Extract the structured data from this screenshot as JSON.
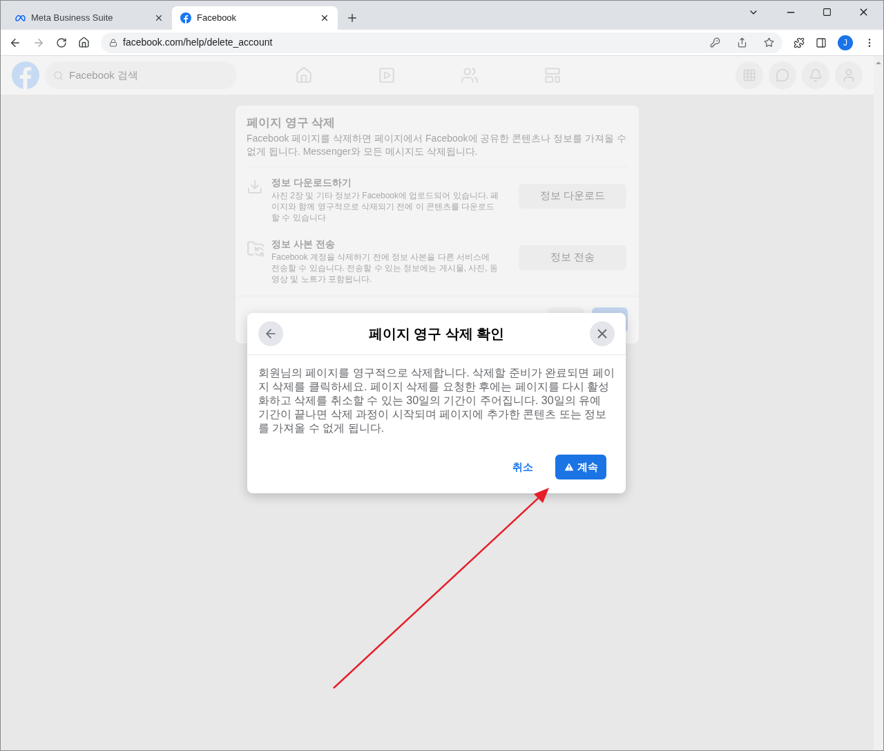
{
  "browser": {
    "tabs": [
      {
        "title": "Meta Business Suite",
        "selected": false
      },
      {
        "title": "Facebook",
        "selected": true
      }
    ],
    "address": "facebook.com/help/delete_account",
    "profile_initial": "J"
  },
  "header": {
    "search_placeholder": "Facebook 검색"
  },
  "background_card": {
    "title": "페이지 영구 삭제",
    "description": "Facebook 페이지를 삭제하면 페이지에서 Facebook에 공유한 콘텐츠나 정보를 가져올 수 없게 됩니다. Messenger와 모든 메시지도 삭제됩니다.",
    "options": [
      {
        "kind": "download",
        "title": "정보 다운로드하기",
        "text": "사진 2장 및 기타 정보가 Facebook에 업로드되어 있습니다. 페이지와 함께 영구적으로 삭제되기 전에 이 콘텐츠를 다운로드할 수 있습니다",
        "button": "정보 다운로드"
      },
      {
        "kind": "transfer",
        "title": "정보 사본 전송",
        "text": "Facebook 계정을 삭제하기 전에 정보 사본을 다른 서비스에 전송할 수 있습니다. 전송할 수 있는 정보에는 게시물, 사진, 동영상 및 노트가 포함됩니다.",
        "button": "정보 전송"
      }
    ]
  },
  "dialog": {
    "title": "페이지 영구 삭제 확인",
    "body": "회원님의 페이지를 영구적으로 삭제합니다. 삭제할 준비가 완료되면 페이지 삭제를 클릭하세요. 페이지 삭제를 요청한 후에는 페이지를 다시 활성화하고 삭제를 취소할 수 있는 30일의 기간이 주어집니다. 30일의 유예 기간이 끝나면 삭제 과정이 시작되며 페이지에 추가한 콘텐츠 또는 정보를 가져올 수 없게 됩니다.",
    "cancel": "취소",
    "continue": "계속"
  }
}
